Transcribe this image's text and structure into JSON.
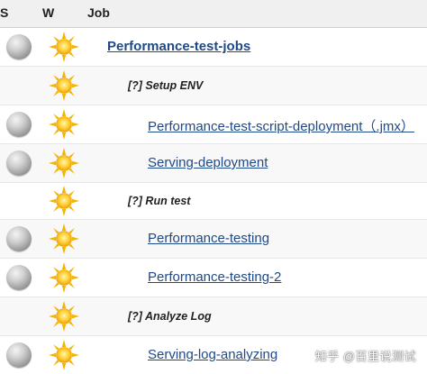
{
  "header": {
    "col_s": "S",
    "col_w": "W",
    "col_job": "Job"
  },
  "rows": [
    {
      "type": "job",
      "status_icon": "grey-ball-icon",
      "weather_icon": "sunny-icon",
      "label": "Performance-test-jobs",
      "level": 0
    },
    {
      "type": "section",
      "weather_icon": "sunny-icon",
      "label": "[?] Setup ENV"
    },
    {
      "type": "job",
      "status_icon": "grey-ball-icon",
      "weather_icon": "sunny-icon",
      "label": "Performance-test-script-deployment（.jmx）",
      "level": 2
    },
    {
      "type": "job",
      "status_icon": "grey-ball-icon",
      "weather_icon": "sunny-icon",
      "label": "Serving-deployment",
      "level": 2
    },
    {
      "type": "section",
      "weather_icon": "sunny-icon",
      "label": "[?] Run test"
    },
    {
      "type": "job",
      "status_icon": "grey-ball-icon",
      "weather_icon": "sunny-icon",
      "label": "Performance-testing",
      "level": 2
    },
    {
      "type": "job",
      "status_icon": "grey-ball-icon",
      "weather_icon": "sunny-icon",
      "label": "Performance-testing-2",
      "level": 2
    },
    {
      "type": "section",
      "weather_icon": "sunny-icon",
      "label": "[?] Analyze Log"
    },
    {
      "type": "job",
      "status_icon": "grey-ball-icon",
      "weather_icon": "sunny-icon",
      "label": "Serving-log-analyzing",
      "level": 2
    }
  ],
  "watermark": "知乎 @百里说测试",
  "colors": {
    "link": "#204a87",
    "header_bg": "#f0f0f0",
    "sun": "#f7b500"
  }
}
